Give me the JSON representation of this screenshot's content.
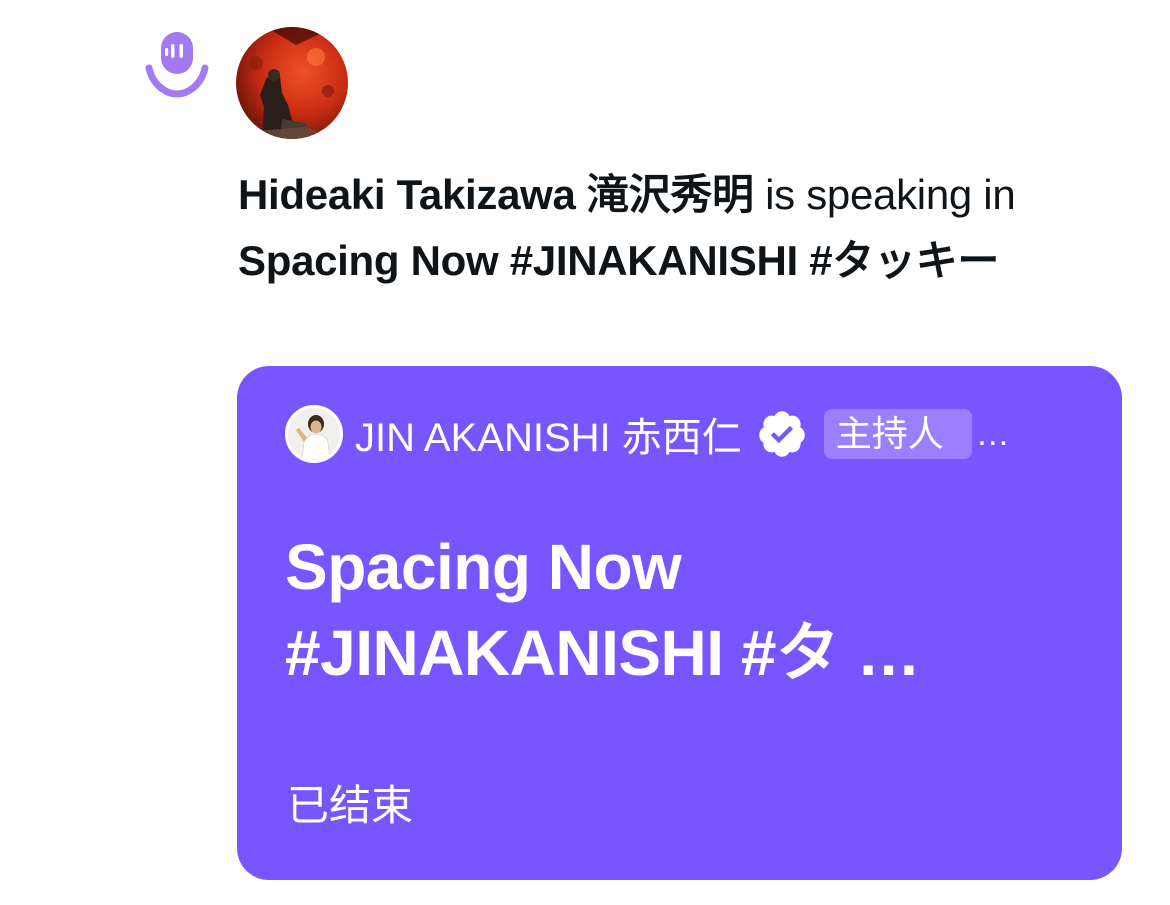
{
  "activity": {
    "speaker_name": "Hideaki Takizawa 滝沢秀明",
    "speaking_text": " is speaking in ",
    "space_title": "Spacing Now #JINAKANISHI #タッキー"
  },
  "space_card": {
    "host_name": "JIN AKANISHI 赤西仁",
    "host_badge": "主持人",
    "host_badge_overflow": "…",
    "title_line1": "Spacing Now",
    "title_line2": "#JINAKANISHI #タ …",
    "status": "已结束"
  },
  "colors": {
    "spaces_purple": "#7856ff",
    "spaces_icon": "#a27bf3",
    "text_primary": "#0f1419"
  },
  "icons": {
    "spaces": "spaces-microphone-icon",
    "verified": "verified-badge-icon"
  }
}
